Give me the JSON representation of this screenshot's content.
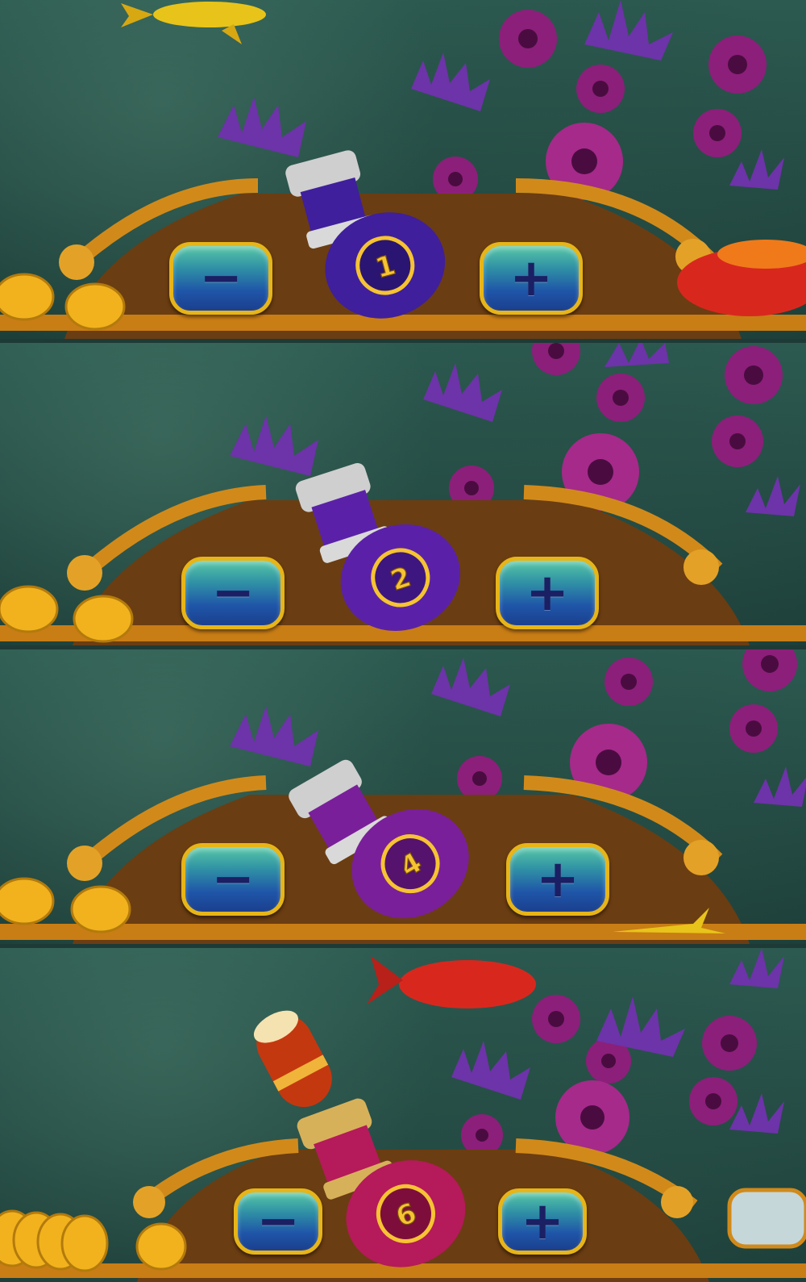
{
  "panels": [
    {
      "cannon_level": "1",
      "minus_label": "−",
      "plus_label": "+",
      "cannon_color": "#3f1f9c",
      "cannon_icon": "cannon-icon"
    },
    {
      "cannon_level": "2",
      "minus_label": "−",
      "plus_label": "+",
      "cannon_color": "#5a21a8",
      "cannon_icon": "cannon-icon"
    },
    {
      "cannon_level": "4",
      "minus_label": "−",
      "plus_label": "+",
      "cannon_color": "#7a1f9a",
      "cannon_icon": "cannon-icon"
    },
    {
      "cannon_level": "6",
      "minus_label": "−",
      "plus_label": "+",
      "cannon_color": "#b51a5a",
      "cannon_icon": "cannon-icon"
    }
  ],
  "colors": {
    "water": "#2c5a50",
    "coral_purple": "#6d33a8",
    "anemone_magenta": "#8c1f7a",
    "rail_gold": "#d18a1a",
    "coin_gold": "#f1b21e",
    "button_border": "#e7b518"
  }
}
